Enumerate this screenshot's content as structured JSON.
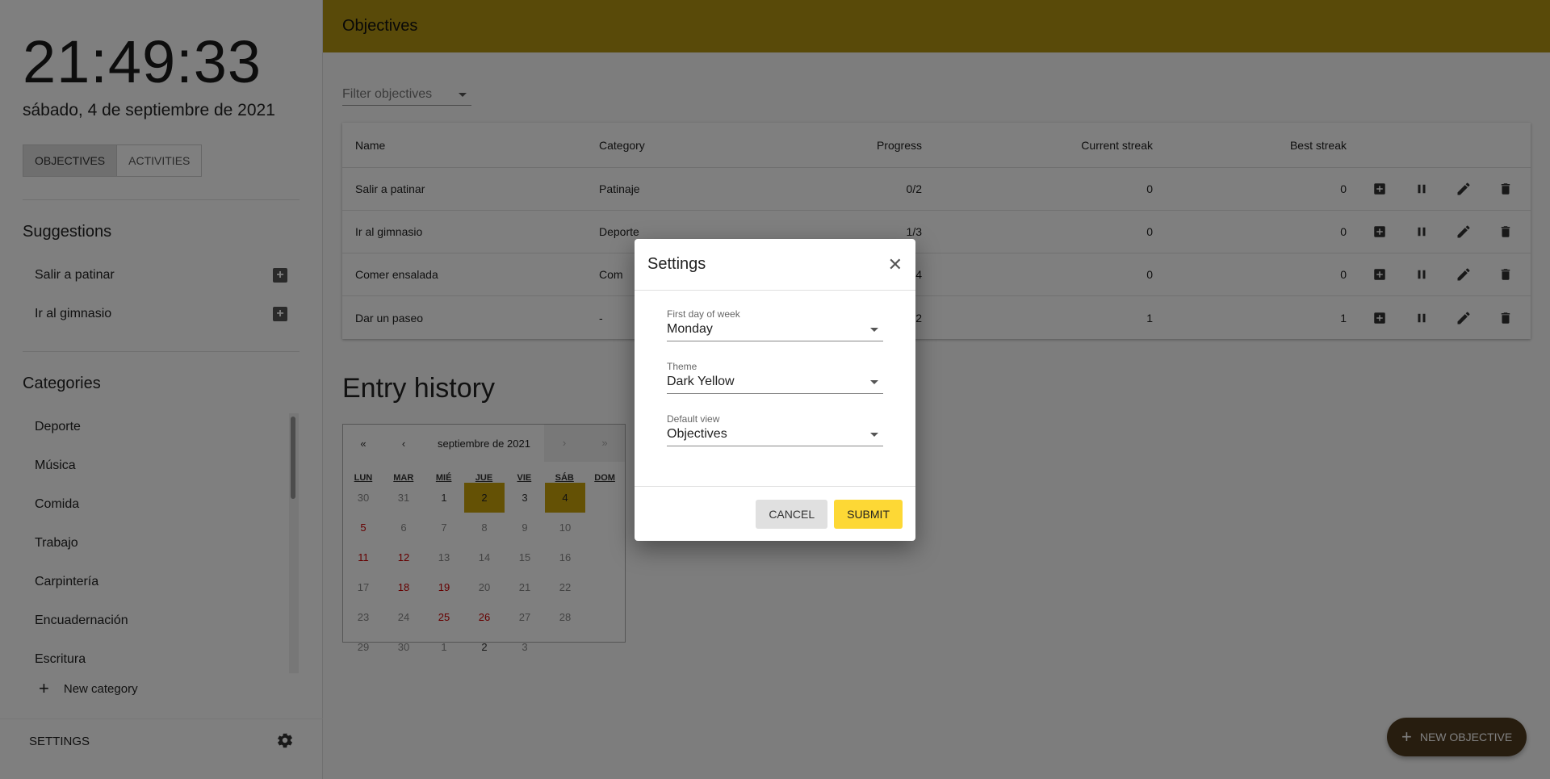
{
  "sidebar": {
    "clock": "21:49:33",
    "date": "sábado, 4 de septiembre de 2021",
    "tabs": [
      {
        "label": "OBJECTIVES",
        "active": true
      },
      {
        "label": "ACTIVITIES",
        "active": false
      }
    ],
    "suggestions_title": "Suggestions",
    "suggestions": [
      "Salir a patinar",
      "Ir al gimnasio"
    ],
    "categories_title": "Categories",
    "categories": [
      "Deporte",
      "Música",
      "Comida",
      "Trabajo",
      "Carpintería",
      "Encuadernación",
      "Escritura"
    ],
    "new_category": "New category",
    "settings_label": "SETTINGS"
  },
  "header": {
    "title": "Objectives"
  },
  "filter": {
    "placeholder": "Filter objectives"
  },
  "table": {
    "headers": [
      "Name",
      "Category",
      "Progress",
      "Current streak",
      "Best streak"
    ],
    "rows": [
      {
        "name": "Salir a patinar",
        "category": "Patinaje",
        "progress": "0/2",
        "current": "0",
        "best": "0"
      },
      {
        "name": "Ir al gimnasio",
        "category": "Deporte",
        "progress": "1/3",
        "current": "0",
        "best": "0"
      },
      {
        "name": "Comer ensalada",
        "category": "Com",
        "progress": "4",
        "current": "0",
        "best": "0"
      },
      {
        "name": "Dar un paseo",
        "category": "-",
        "progress": "2",
        "current": "1",
        "best": "1"
      }
    ]
  },
  "entry_history": {
    "title": "Entry history",
    "nav": {
      "first": "«",
      "prev": "‹",
      "month": "septiembre de 2021",
      "next": "›",
      "last": "»"
    },
    "dows": [
      "LUN",
      "MAR",
      "MIÉ",
      "JUE",
      "VIE",
      "SÁB",
      "DOM"
    ],
    "days": [
      {
        "d": "30",
        "t": "other"
      },
      {
        "d": "31",
        "t": "other"
      },
      {
        "d": "1",
        "t": ""
      },
      {
        "d": "2",
        "t": "marked"
      },
      {
        "d": "3",
        "t": ""
      },
      {
        "d": "4",
        "t": "marked"
      },
      {
        "d": "5",
        "t": "weekend"
      },
      {
        "d": "6",
        "t": "past"
      },
      {
        "d": "7",
        "t": "past"
      },
      {
        "d": "8",
        "t": "past"
      },
      {
        "d": "9",
        "t": "past"
      },
      {
        "d": "10",
        "t": "past"
      },
      {
        "d": "11",
        "t": "weekend"
      },
      {
        "d": "12",
        "t": "weekend"
      },
      {
        "d": "13",
        "t": "past"
      },
      {
        "d": "14",
        "t": "past"
      },
      {
        "d": "15",
        "t": "past"
      },
      {
        "d": "16",
        "t": "past"
      },
      {
        "d": "17",
        "t": "past"
      },
      {
        "d": "18",
        "t": "weekend"
      },
      {
        "d": "19",
        "t": "weekend"
      },
      {
        "d": "20",
        "t": "past"
      },
      {
        "d": "21",
        "t": "past"
      },
      {
        "d": "22",
        "t": "past"
      },
      {
        "d": "23",
        "t": "past"
      },
      {
        "d": "24",
        "t": "past"
      },
      {
        "d": "25",
        "t": "weekend"
      },
      {
        "d": "26",
        "t": "weekend"
      },
      {
        "d": "27",
        "t": "past"
      },
      {
        "d": "28",
        "t": "past"
      },
      {
        "d": "29",
        "t": "past"
      },
      {
        "d": "30",
        "t": "past"
      },
      {
        "d": "1",
        "t": "other"
      },
      {
        "d": "2",
        "t": ""
      },
      {
        "d": "3",
        "t": "other"
      }
    ]
  },
  "fab": {
    "label": "NEW OBJECTIVE"
  },
  "dialog": {
    "title": "Settings",
    "fields": [
      {
        "label": "First day of week",
        "value": "Monday"
      },
      {
        "label": "Theme",
        "value": "Dark Yellow"
      },
      {
        "label": "Default view",
        "value": "Objectives"
      }
    ],
    "cancel": "CANCEL",
    "submit": "SUBMIT"
  },
  "colors": {
    "accent": "#b39412",
    "submit": "#fdd835",
    "fab": "#4f3a1f",
    "weekend": "#cc0000"
  }
}
